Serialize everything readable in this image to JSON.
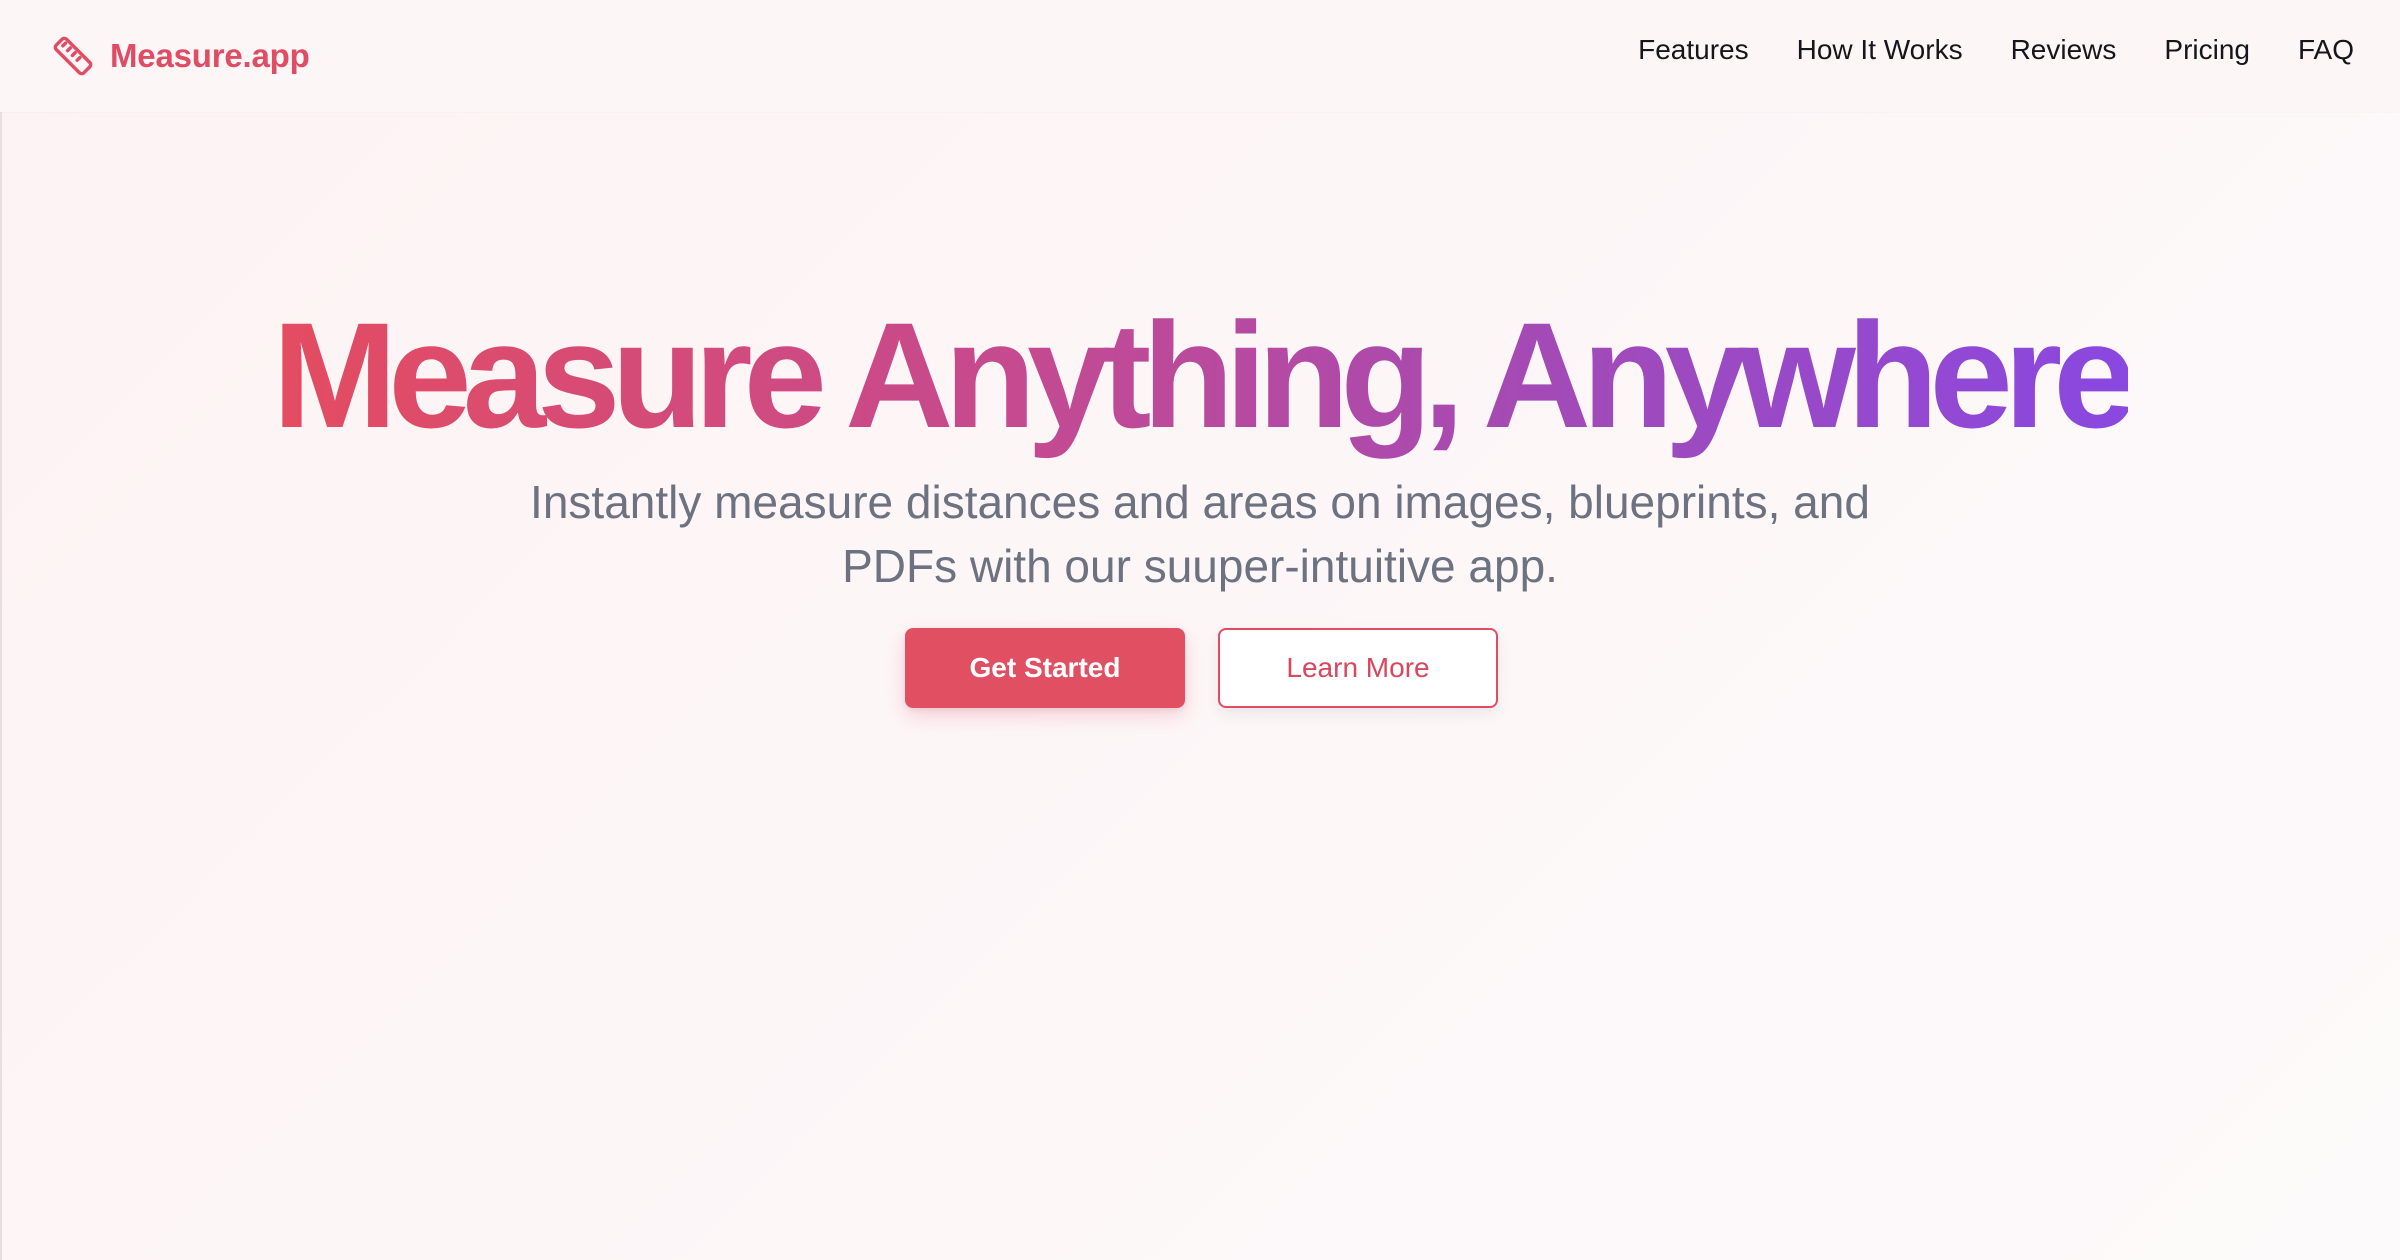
{
  "colors": {
    "brand": "#e04c63",
    "gradient_start": "#e44c60",
    "gradient_end": "#8a48e0",
    "subtitle": "#6c7280",
    "nav_text": "#15161a"
  },
  "navbar": {
    "logo_icon": "ruler-icon",
    "brand_name": "Measure.app",
    "links": [
      {
        "label": "Features"
      },
      {
        "label": "How It Works"
      },
      {
        "label": "Reviews"
      },
      {
        "label": "Pricing"
      },
      {
        "label": "FAQ"
      }
    ]
  },
  "hero": {
    "title": "Measure Anything, Anywhere",
    "subtitle_line1": "Instantly measure distances and areas on images, blueprints, and",
    "subtitle_line2": "PDFs with our suuper-intuitive app.",
    "primary_cta": "Get Started",
    "secondary_cta": "Learn More"
  }
}
